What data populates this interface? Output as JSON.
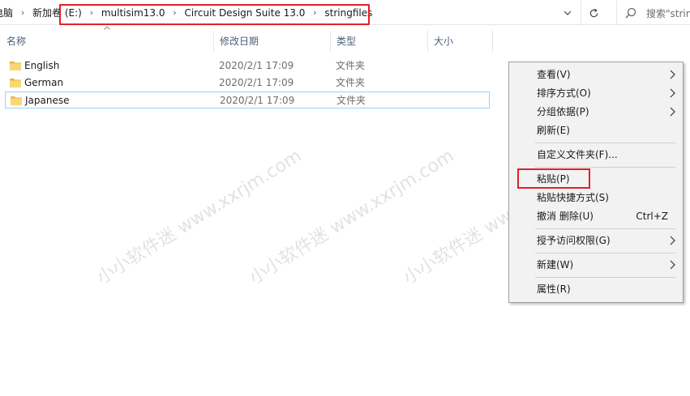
{
  "breadcrumb": {
    "items": [
      "电脑",
      "新加卷 (E:)",
      "multisim13.0",
      "Circuit Design Suite 13.0",
      "stringfiles"
    ],
    "separator": "›"
  },
  "search": {
    "placeholder": "搜索\"strin"
  },
  "columns": {
    "name": "名称",
    "modified": "修改日期",
    "type": "类型",
    "size": "大小"
  },
  "files": [
    {
      "name": "English",
      "modified": "2020/2/1 17:09",
      "type": "文件夹"
    },
    {
      "name": "German",
      "modified": "2020/2/1 17:09",
      "type": "文件夹"
    },
    {
      "name": "Japanese",
      "modified": "2020/2/1 17:09",
      "type": "文件夹",
      "selected": true
    }
  ],
  "context_menu": {
    "view": "查看(V)",
    "sort": "排序方式(O)",
    "group": "分组依据(P)",
    "refresh": "刷新(E)",
    "customize": "自定义文件夹(F)...",
    "paste": "粘贴(P)",
    "paste_shortcut": "粘贴快捷方式(S)",
    "undo_delete": "撤消 删除(U)",
    "undo_shortcut": "Ctrl+Z",
    "grant_access": "授予访问权限(G)",
    "new": "新建(W)",
    "properties": "属性(R)"
  },
  "watermark": "小小软件迷 www.xxrjm.com",
  "colors": {
    "highlight": "#e0202a",
    "folder": "#f8d775",
    "selection_border": "#99d1ff",
    "header_text": "#4c607a"
  },
  "icons": [
    "chevron-down-icon",
    "refresh-icon",
    "search-icon",
    "folder-icon",
    "chevron-right-icon",
    "sort-up-icon"
  ]
}
